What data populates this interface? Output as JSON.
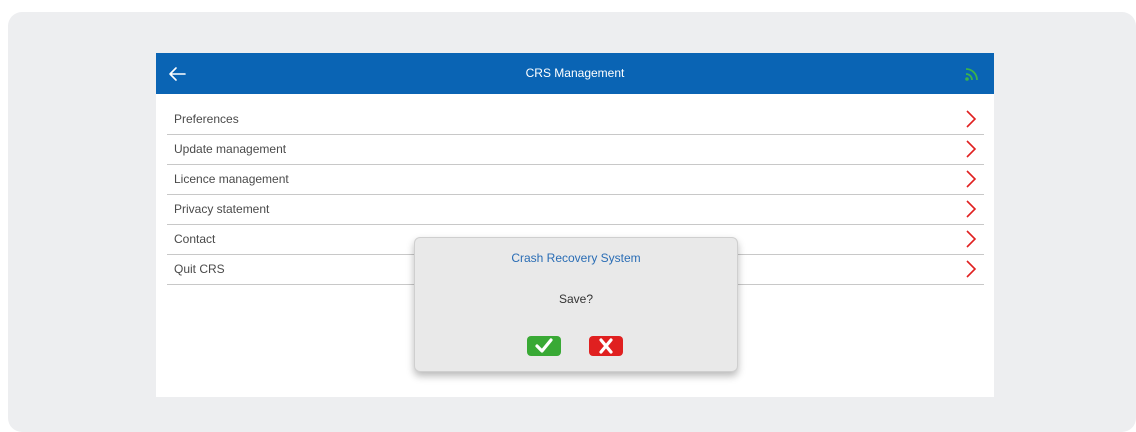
{
  "header": {
    "title": "CRS Management",
    "back_icon": "arrow-left-icon",
    "status_icon": "signal-icon"
  },
  "menu": {
    "items": [
      {
        "label": "Preferences"
      },
      {
        "label": "Update management"
      },
      {
        "label": "Licence management"
      },
      {
        "label": "Privacy statement"
      },
      {
        "label": "Contact"
      },
      {
        "label": "Quit CRS"
      }
    ],
    "item_icon": "chevron-right-icon"
  },
  "dialog": {
    "title": "Crash Recovery System",
    "message": "Save?",
    "confirm_icon": "checkmark-icon",
    "cancel_icon": "x-icon"
  },
  "colors": {
    "header_background": "#0a64b4",
    "chevron": "#e02020",
    "signal": "#3bb34a",
    "confirm": "#39a935",
    "cancel": "#e02020",
    "dialog_title": "#2a6db5"
  }
}
